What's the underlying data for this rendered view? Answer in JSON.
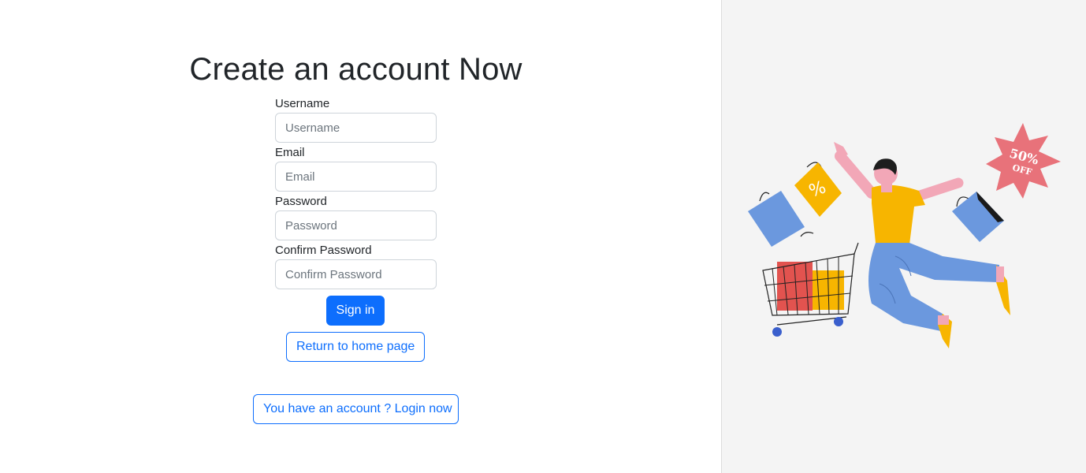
{
  "page": {
    "title": "Create an account Now"
  },
  "form": {
    "username": {
      "label": "Username",
      "placeholder": "Username",
      "value": ""
    },
    "email": {
      "label": "Email",
      "placeholder": "Email",
      "value": ""
    },
    "password": {
      "label": "Password",
      "placeholder": "Password",
      "value": ""
    },
    "confirm_password": {
      "label": "Confirm Password",
      "placeholder": "Confirm Password",
      "value": ""
    }
  },
  "buttons": {
    "sign_in": "Sign in",
    "return_home": "Return to home page",
    "login": "You have an account ? Login now"
  },
  "illustration": {
    "badge_percent": "50%",
    "badge_text": "OFF",
    "icons": [
      "shopping-bag-icon",
      "shopping-cart-icon",
      "discount-badge-icon",
      "person-illustration"
    ]
  },
  "colors": {
    "primary": "#0d6efd",
    "right_panel_bg": "#f4f4f4",
    "badge": "#e8727a",
    "shirt": "#f7b500",
    "jeans": "#6b98de",
    "skin": "#f2a7b7"
  }
}
